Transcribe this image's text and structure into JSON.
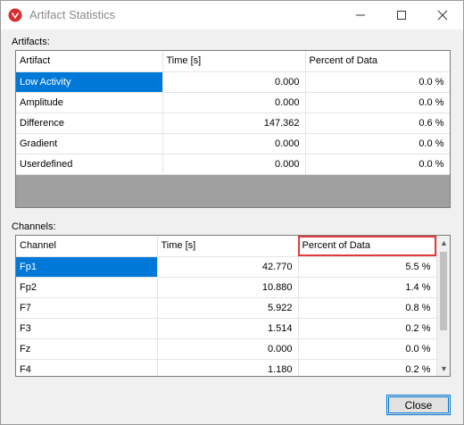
{
  "window": {
    "title": "Artifact Statistics"
  },
  "artifacts": {
    "label": "Artifacts:",
    "columns": [
      "Artifact",
      "Time [s]",
      "Percent of Data"
    ],
    "rows": [
      {
        "name": "Low Activity",
        "time": "0.000",
        "percent": "0.0 %"
      },
      {
        "name": "Amplitude",
        "time": "0.000",
        "percent": "0.0 %"
      },
      {
        "name": "Difference",
        "time": "147.362",
        "percent": "0.6 %"
      },
      {
        "name": "Gradient",
        "time": "0.000",
        "percent": "0.0 %"
      },
      {
        "name": "Userdefined",
        "time": "0.000",
        "percent": "0.0 %"
      }
    ]
  },
  "channels": {
    "label": "Channels:",
    "columns": [
      "Channel",
      "Time [s]",
      "Percent of Data"
    ],
    "rows": [
      {
        "name": "Fp1",
        "time": "42.770",
        "percent": "5.5 %"
      },
      {
        "name": "Fp2",
        "time": "10.880",
        "percent": "1.4 %"
      },
      {
        "name": "F7",
        "time": "5.922",
        "percent": "0.8 %"
      },
      {
        "name": "F3",
        "time": "1.514",
        "percent": "0.2 %"
      },
      {
        "name": "Fz",
        "time": "0.000",
        "percent": "0.0 %"
      },
      {
        "name": "F4",
        "time": "1.180",
        "percent": "0.2 %"
      }
    ]
  },
  "buttons": {
    "close_label": "Close"
  },
  "colors": {
    "selection": "#0078d7",
    "highlight_border": "#e23b3b",
    "empty_area": "#a0a0a0"
  }
}
